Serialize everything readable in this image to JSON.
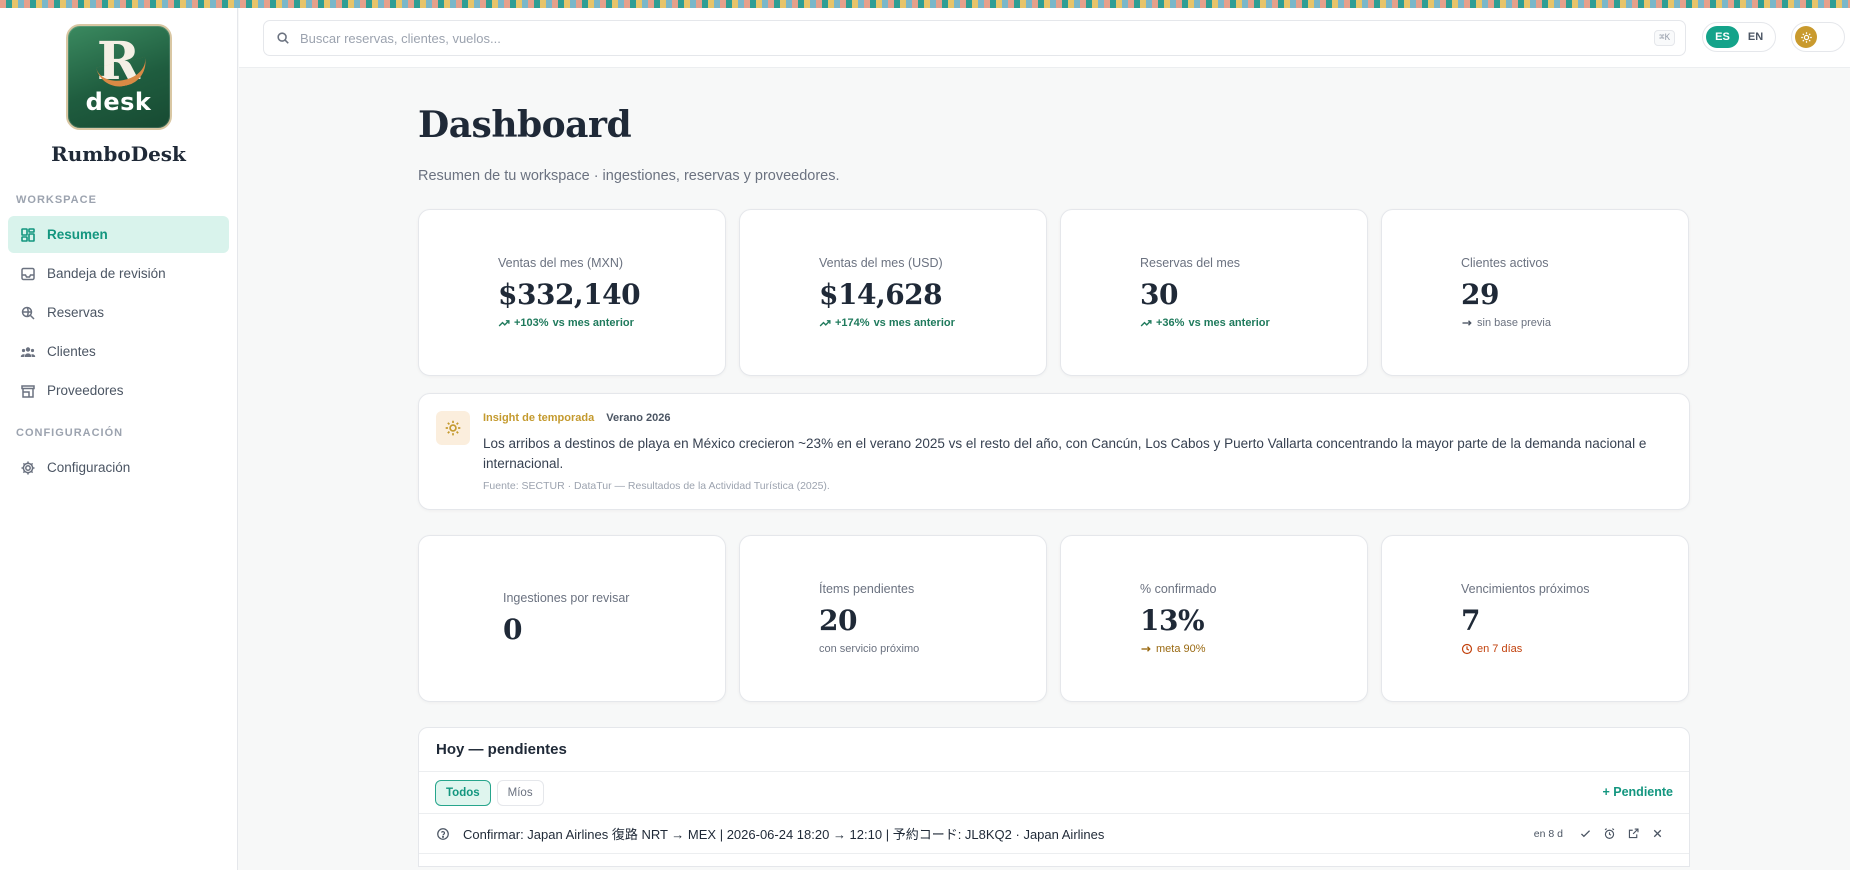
{
  "brand": {
    "name": "RumboDesk",
    "logo_letter": "R",
    "logo_word": "desk"
  },
  "sidebar": {
    "sections": [
      {
        "title": "WORKSPACE",
        "items": [
          {
            "label": "Resumen",
            "icon": "dashboard-grid-icon",
            "active": true
          },
          {
            "label": "Bandeja de revisión",
            "icon": "inbox-tray-icon"
          },
          {
            "label": "Reservas",
            "icon": "search-globe-icon"
          },
          {
            "label": "Clientes",
            "icon": "users-icon"
          },
          {
            "label": "Proveedores",
            "icon": "storefront-icon"
          }
        ]
      },
      {
        "title": "CONFIGURACIÓN",
        "items": [
          {
            "label": "Configuración",
            "icon": "gear-icon"
          }
        ]
      }
    ]
  },
  "topbar": {
    "search_placeholder": "Buscar reservas, clientes, vuelos...",
    "shortcut": "⌘K",
    "languages": [
      "ES",
      "EN"
    ],
    "active_language": "ES",
    "theme_icon": "sun-icon"
  },
  "page": {
    "title": "Dashboard",
    "subtitle": "Resumen de tu workspace · ingestiones, reservas y proveedores."
  },
  "kpis": [
    {
      "label": "Ventas del mes (MXN)",
      "value": "$332,140",
      "delta": "+103%",
      "delta_suffix": "vs mes anterior"
    },
    {
      "label": "Ventas del mes (USD)",
      "value": "$14,628",
      "delta": "+174%",
      "delta_suffix": "vs mes anterior"
    },
    {
      "label": "Reservas del mes",
      "value": "30",
      "delta": "+36%",
      "delta_suffix": "vs mes anterior"
    },
    {
      "label": "Clientes activos",
      "value": "29",
      "delta": "sin base previa"
    }
  ],
  "insight": {
    "tag": "Insight de temporada",
    "season": "Verano 2026",
    "body": "Los arribos a destinos de playa en México crecieron ~23% en el verano 2025 vs el resto del año, con Cancún, Los Cabos y Puerto Vallarta concentrando la mayor parte de la demanda nacional e internacional.",
    "source": "Fuente: SECTUR · DataTur — Resultados de la Actividad Turística (2025).",
    "accent": "#c49a2e"
  },
  "ops": [
    {
      "label": "Ingestiones por revisar",
      "value": "0"
    },
    {
      "label": "Ítems pendientes",
      "value": "20",
      "note": "con servicio próximo"
    },
    {
      "label": "% confirmado",
      "value": "13%",
      "note": "meta 90%"
    },
    {
      "label": "Vencimientos próximos",
      "value": "7",
      "note": "en 7 días"
    }
  ],
  "pending": {
    "title": "Hoy — pendientes",
    "filters": [
      "Todos",
      "Míos"
    ],
    "active_filter": "Todos",
    "add_label": "+ Pendiente",
    "rows": [
      {
        "text": "Confirmar: Japan Airlines 復路 NRT → MEX | 2026-06-24 18:20 → 12:10 | 予約コード: JL8KQ2 · Japan Airlines",
        "due": "en 8 d"
      }
    ]
  },
  "colors": {
    "accent": "#13967f",
    "accent_bg": "#d9f3ec",
    "positive": "#1f7a5c",
    "warning": "#9a6a12",
    "danger": "#c2410c"
  }
}
